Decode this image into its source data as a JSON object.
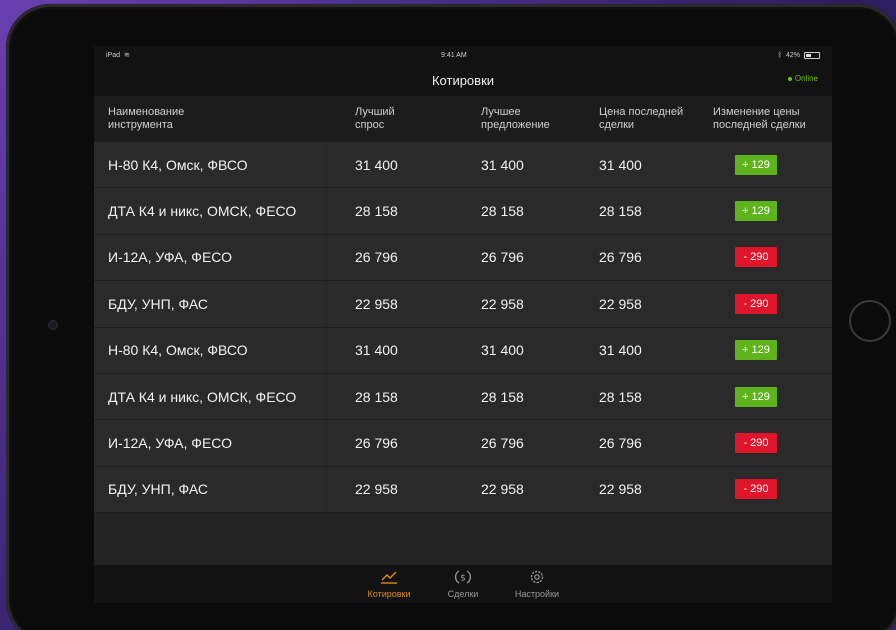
{
  "statusbar": {
    "device": "iPad",
    "time": "9:41 AM",
    "battery_text": "42%",
    "battery_level": 0.42
  },
  "header": {
    "title": "Котировки",
    "status": "Online"
  },
  "table": {
    "columns": [
      [
        "Наименование",
        "инструмента"
      ],
      [
        "Лучший",
        "спрос"
      ],
      [
        "Лучшее",
        "предложение"
      ],
      [
        "Цена последней",
        "сделки"
      ],
      [
        "Изменение цены",
        "последней сделки"
      ]
    ],
    "rows": [
      {
        "name": "Н-80 К4, Омск, ФВСО",
        "bid": "31 400",
        "ask": "31 400",
        "last": "31 400",
        "change": "+ 129",
        "dir": "up"
      },
      {
        "name": "ДТА К4 и никс, ОМСК, ФЕСО",
        "bid": "28 158",
        "ask": "28 158",
        "last": "28 158",
        "change": "+ 129",
        "dir": "up"
      },
      {
        "name": "И-12А, УФА, ФЕСО",
        "bid": "26 796",
        "ask": "26 796",
        "last": "26 796",
        "change": "- 290",
        "dir": "down"
      },
      {
        "name": "БДУ, УНП, ФАС",
        "bid": "22 958",
        "ask": "22 958",
        "last": "22 958",
        "change": "- 290",
        "dir": "down"
      },
      {
        "name": "Н-80 К4, Омск, ФВСО",
        "bid": "31 400",
        "ask": "31 400",
        "last": "31 400",
        "change": "+ 129",
        "dir": "up"
      },
      {
        "name": "ДТА К4 и никс, ОМСК, ФЕСО",
        "bid": "28 158",
        "ask": "28 158",
        "last": "28 158",
        "change": "+ 129",
        "dir": "up"
      },
      {
        "name": "И-12А, УФА, ФЕСО",
        "bid": "26 796",
        "ask": "26 796",
        "last": "26 796",
        "change": "- 290",
        "dir": "down"
      },
      {
        "name": "БДУ, УНП, ФАС",
        "bid": "22 958",
        "ask": "22 958",
        "last": "22 958",
        "change": "- 290",
        "dir": "down"
      }
    ]
  },
  "tabs": [
    {
      "label": "Котировки",
      "icon": "chart-line-icon",
      "active": true
    },
    {
      "label": "Сделки",
      "icon": "dollar-circle-icon",
      "active": false
    },
    {
      "label": "Настройки",
      "icon": "gear-icon",
      "active": false
    }
  ],
  "colors": {
    "accent": "#e38a18",
    "up": "#5fb31d",
    "down": "#e0142b",
    "online": "#6cc020"
  }
}
